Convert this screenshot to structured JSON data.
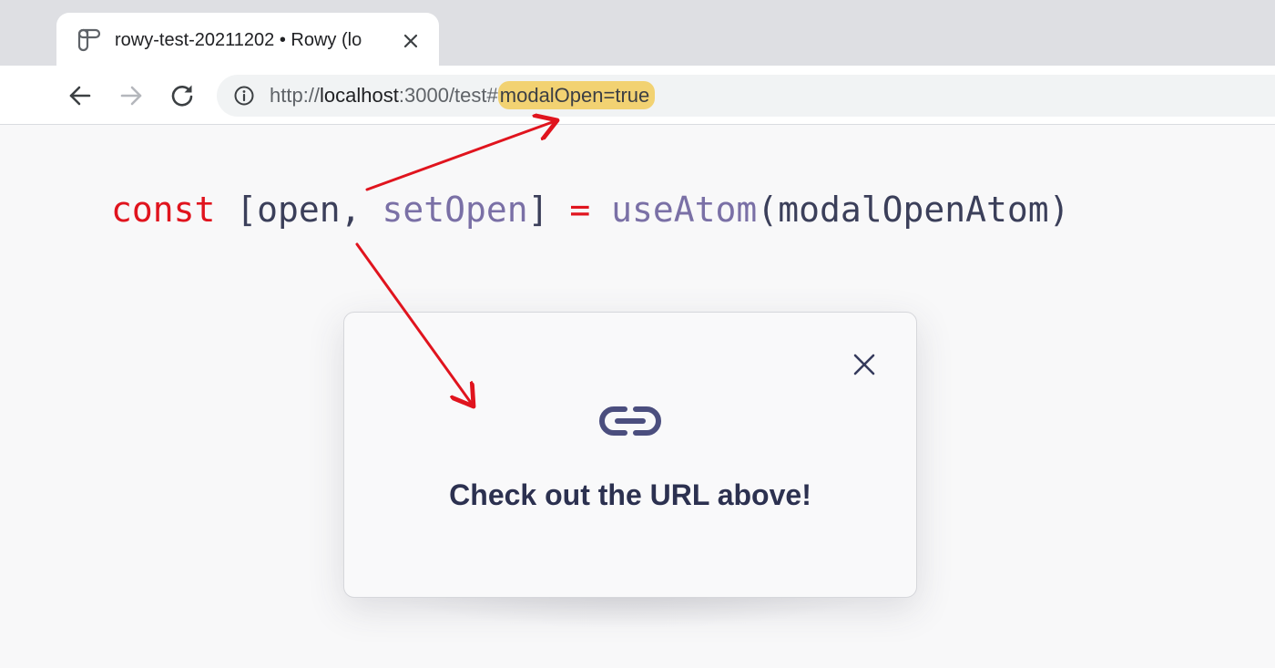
{
  "browser": {
    "tab": {
      "title": "rowy-test-20211202 • Rowy (lo",
      "favicon": "rowy-logo-icon",
      "close_icon": "close-icon"
    },
    "toolbar": {
      "back_icon": "back-arrow-icon",
      "forward_icon": "forward-arrow-icon",
      "reload_icon": "reload-icon",
      "site_info_icon": "info-icon"
    },
    "address": {
      "scheme": "http://",
      "host": "localhost",
      "path": ":3000/test#",
      "hash_highlighted": "modalOpen=true",
      "highlight_color": "#f2d272"
    }
  },
  "code": {
    "kw": "const",
    "open_bracket": " [",
    "var1": "open",
    "comma": ", ",
    "var2": "setOpen",
    "close_bracket": "] ",
    "op": "=",
    "space": " ",
    "fn": "useAtom",
    "paren_open": "(",
    "arg": "modalOpenAtom",
    "paren_close": ")",
    "colors": {
      "keyword": "#e0141e",
      "function": "#7a70a6",
      "text": "#3b3f5a"
    }
  },
  "modal": {
    "icon": "link-icon",
    "close_icon": "close-icon",
    "title": "Check out the URL above!"
  },
  "annotations": {
    "arrow_color": "#e0141e"
  }
}
